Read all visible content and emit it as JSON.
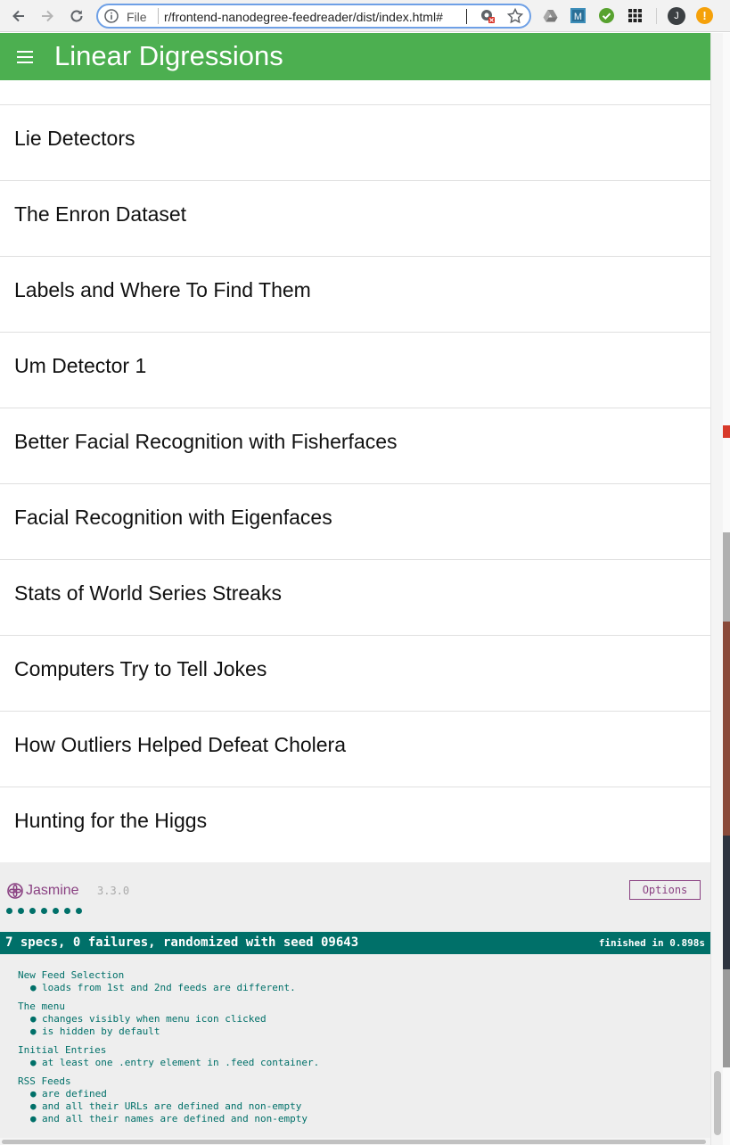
{
  "browser": {
    "scheme_label": "File",
    "url": "r/frontend-nanodegree-feedreader/dist/index.html#",
    "profile_initial": "J",
    "extension_icons": [
      "drive-icon",
      "m-extension-icon",
      "check-extension-icon",
      "apps-grid-icon"
    ],
    "alert_glyph": "!"
  },
  "header": {
    "title": "Linear Digressions",
    "color": "#4caf50"
  },
  "feed": {
    "entries": [
      "Lie Detectors",
      "The Enron Dataset",
      "Labels and Where To Find Them",
      "Um Detector 1",
      "Better Facial Recognition with Fisherfaces",
      "Facial Recognition with Eigenfaces",
      "Stats of World Series Streaks",
      "Computers Try to Tell Jokes",
      "How Outliers Helped Defeat Cholera",
      "Hunting for the Higgs"
    ]
  },
  "jasmine": {
    "logo_text": "Jasmine",
    "version": "3.3.0",
    "options_label": "Options",
    "passed_spec_count": 7,
    "summary": "7 specs, 0 failures, randomized with seed 09643",
    "duration": "finished in 0.898s",
    "accent_color": "#007069",
    "brand_color": "#8a4182",
    "suites": [
      {
        "title": "New Feed Selection",
        "specs": [
          "loads from 1st and 2nd feeds are different."
        ]
      },
      {
        "title": "The menu",
        "specs": [
          "changes visibly when menu icon clicked",
          "is hidden by default"
        ]
      },
      {
        "title": "Initial Entries",
        "specs": [
          "at least one .entry element in .feed container."
        ]
      },
      {
        "title": "RSS Feeds",
        "specs": [
          "are defined",
          "and all their URLs are defined and non-empty",
          "and all their names are defined and non-empty"
        ]
      }
    ]
  }
}
